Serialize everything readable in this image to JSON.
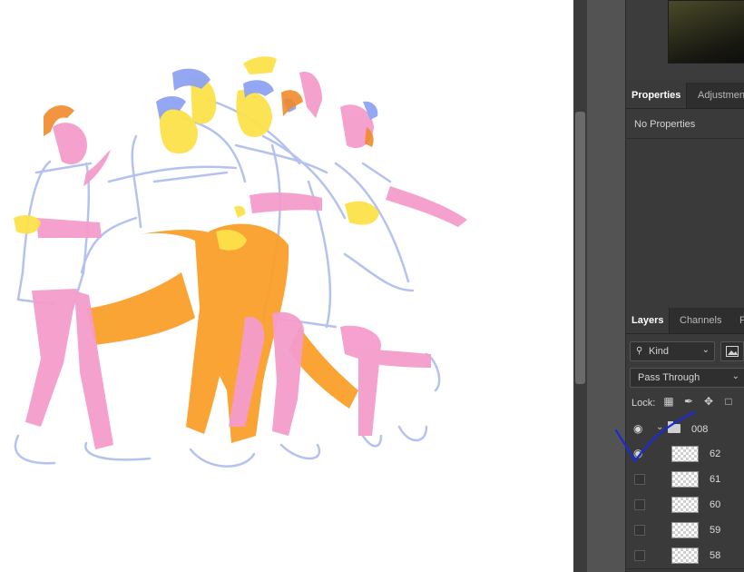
{
  "properties_panel": {
    "tabs": [
      "Properties",
      "Adjustmen"
    ],
    "empty_text": "No Properties"
  },
  "layers_panel": {
    "tabs": [
      "Layers",
      "Channels",
      "P"
    ],
    "filter_kind": "Kind",
    "blend_mode": "Pass Through",
    "lock_label": "Lock:",
    "group": {
      "name": "008",
      "visible": true,
      "expanded": true
    },
    "layers": [
      {
        "name": "62",
        "visible": true
      },
      {
        "name": "61",
        "visible": false
      },
      {
        "name": "60",
        "visible": false
      },
      {
        "name": "59",
        "visible": false
      },
      {
        "name": "58",
        "visible": false
      }
    ]
  },
  "colors": {
    "canvas_bg": "#ffffff",
    "panel_bg": "#3a3a3a",
    "pink": "#f59ccc",
    "orange": "#f9a02a",
    "yellow": "#fbe24a",
    "blue": "#8ea3f2",
    "annotation_ink": "#1a2bd4"
  },
  "icons": {
    "search": "search-icon",
    "eye": "eye-icon",
    "folder": "folder-icon",
    "lock_transparent": "lock-transparent-pixels-icon",
    "lock_paint": "brush-lock-icon",
    "lock_move": "move-lock-icon",
    "lock_artboard": "artboard-lock-icon"
  }
}
